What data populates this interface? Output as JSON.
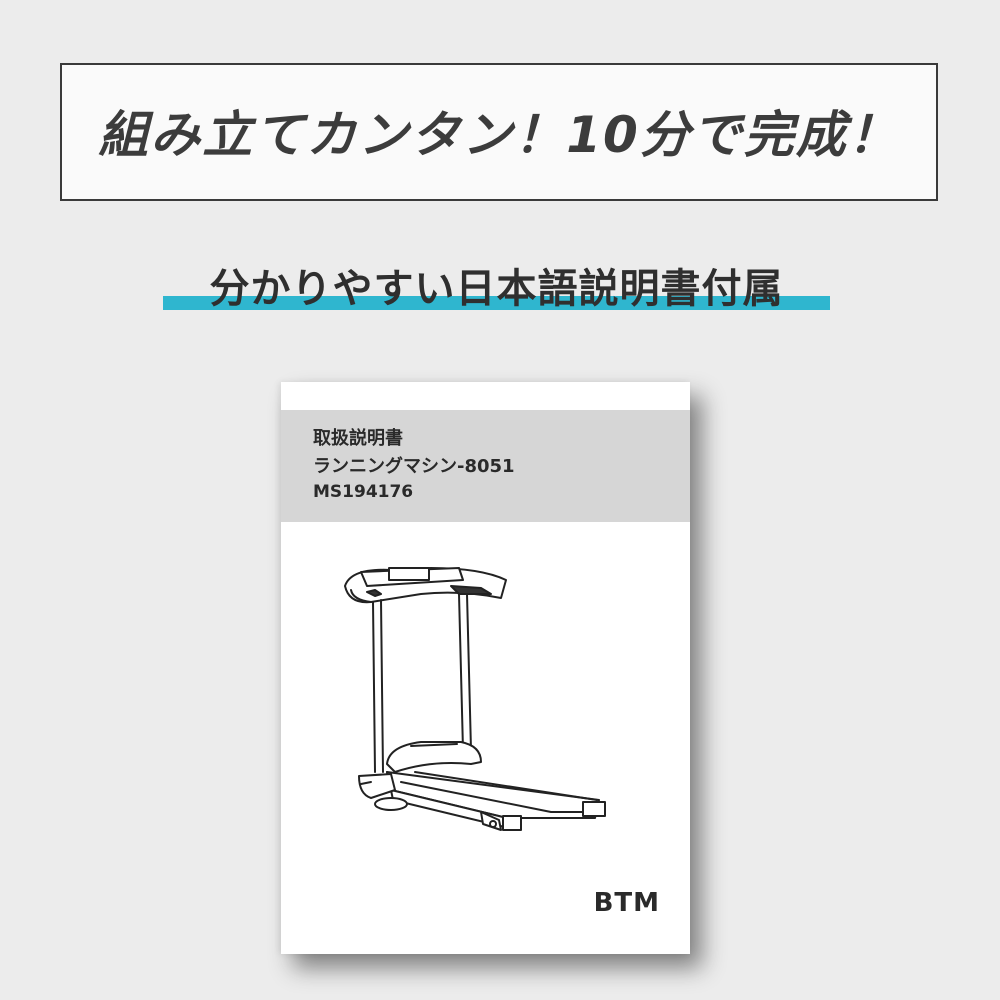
{
  "headline": "組み立てカンタン！10分で完成！",
  "subtitle": "分かりやすい日本語説明書付属",
  "manual": {
    "title": "取扱説明書",
    "product": "ランニングマシン-8051",
    "model": "MS194176",
    "brand_logo": "BTM"
  },
  "colors": {
    "accent_bar": "#2fb6cf",
    "logo_accent": "#e4a21a"
  }
}
